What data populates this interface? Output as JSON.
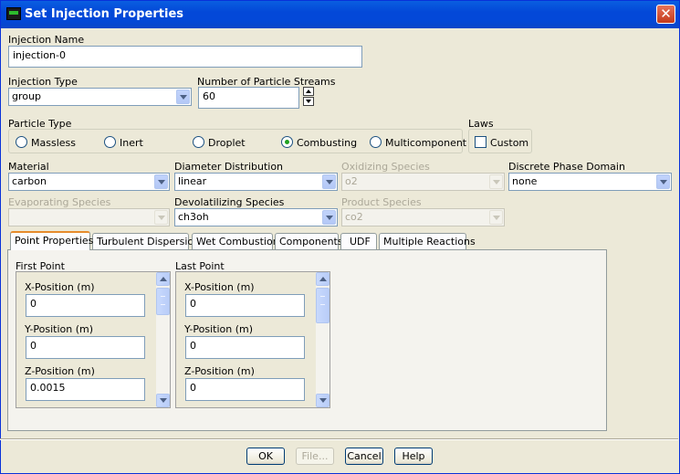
{
  "window": {
    "title": "Set Injection Properties",
    "close_glyph": "✕"
  },
  "injection_name": {
    "label": "Injection Name",
    "value": "injection-0"
  },
  "injection_type": {
    "label": "Injection Type",
    "value": "group"
  },
  "particle_streams": {
    "label": "Number of Particle Streams",
    "value": "60"
  },
  "particle_type": {
    "label": "Particle Type",
    "options": [
      {
        "label": "Massless",
        "selected": false
      },
      {
        "label": "Inert",
        "selected": false
      },
      {
        "label": "Droplet",
        "selected": false
      },
      {
        "label": "Combusting",
        "selected": true
      },
      {
        "label": "Multicomponent",
        "selected": false
      }
    ]
  },
  "laws": {
    "label": "Laws",
    "custom_label": "Custom",
    "custom_checked": false
  },
  "material": {
    "label": "Material",
    "value": "carbon"
  },
  "diameter_distribution": {
    "label": "Diameter Distribution",
    "value": "linear"
  },
  "oxidizing_species": {
    "label": "Oxidizing Species",
    "value": "o2",
    "enabled": false
  },
  "discrete_phase_domain": {
    "label": "Discrete Phase Domain",
    "value": "none"
  },
  "evaporating_species": {
    "label": "Evaporating Species",
    "value": "",
    "enabled": false
  },
  "devolatilizing_species": {
    "label": "Devolatilizing Species",
    "value": "ch3oh"
  },
  "product_species": {
    "label": "Product Species",
    "value": "co2",
    "enabled": false
  },
  "tabs": [
    {
      "label": "Point Properties",
      "active": true
    },
    {
      "label": "Turbulent Dispersion",
      "active": false
    },
    {
      "label": "Wet Combustion",
      "active": false
    },
    {
      "label": "Components",
      "active": false
    },
    {
      "label": "UDF",
      "active": false
    },
    {
      "label": "Multiple Reactions",
      "active": false
    }
  ],
  "first_point": {
    "title": "First Point",
    "x_label": "X-Position (m)",
    "x_value": "0",
    "y_label": "Y-Position (m)",
    "y_value": "0",
    "z_label": "Z-Position (m)",
    "z_value": "0.0015"
  },
  "last_point": {
    "title": "Last Point",
    "x_label": "X-Position (m)",
    "x_value": "0",
    "y_label": "Y-Position (m)",
    "y_value": "0",
    "z_label": "Z-Position (m)",
    "z_value": "0"
  },
  "buttons": {
    "ok": "OK",
    "file": "File...",
    "cancel": "Cancel",
    "help": "Help"
  },
  "colors": {
    "title_bar": "#0348d8",
    "dialog_bg": "#ece9d8",
    "active_tab_accent": "#e68b2c",
    "radio_dot": "#21a121"
  }
}
